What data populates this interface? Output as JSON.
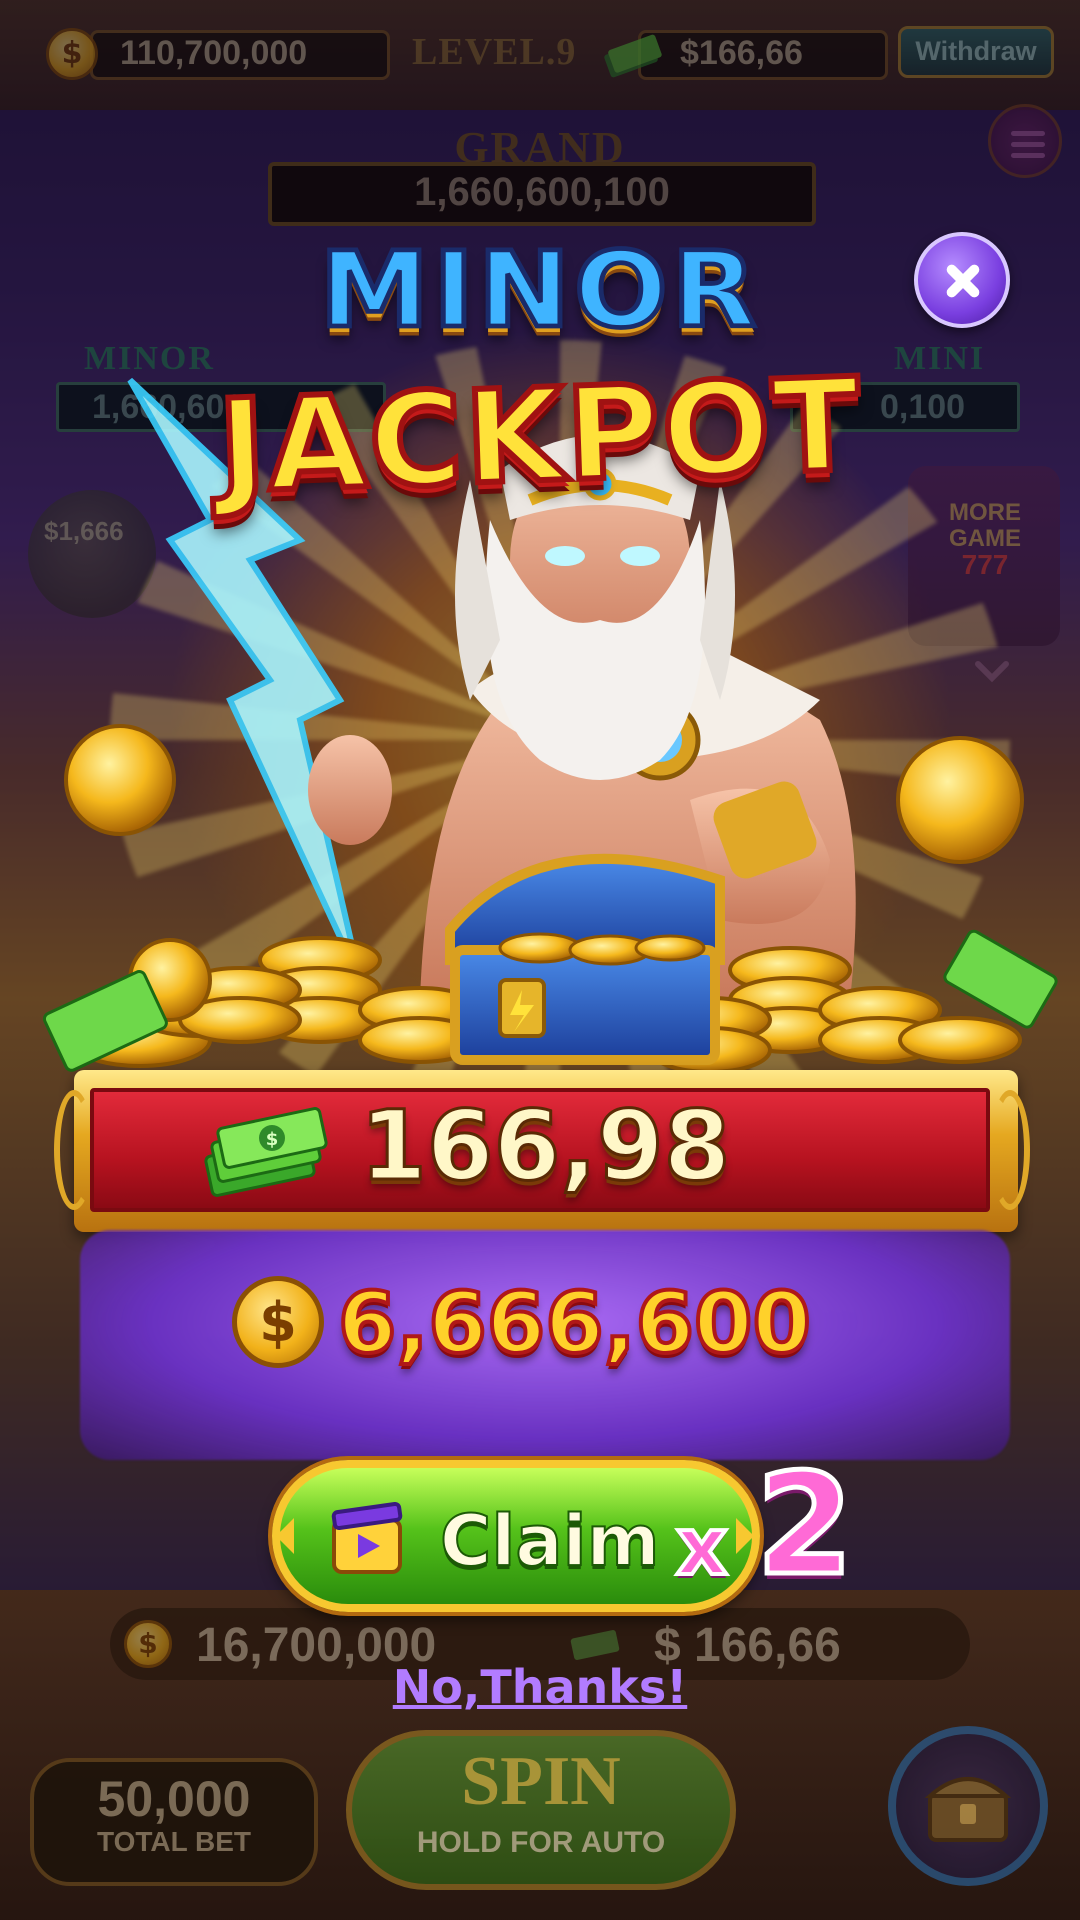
{
  "hud": {
    "coin_balance": "110,700,000",
    "level": "LEVEL.9",
    "cash_balance": "$166,66",
    "withdraw_label": "Withdraw"
  },
  "jackpots": {
    "grand_label": "GRAND",
    "grand_value": "1,660,600,100",
    "minor_label": "MINOR",
    "minor_value_partial": "1,660,600",
    "mini_label": "MINI",
    "mini_value_partial": "0,100"
  },
  "side": {
    "bubble_text": "$1,666",
    "more_game_text": "MORE GAME",
    "more_game_reels": "777"
  },
  "popup": {
    "title_line1": "MINOR",
    "title_line2": "JACKPOT",
    "cash_reward": "166,98",
    "coin_reward": "6,666,600",
    "claim_label": "Claim",
    "multiplier_x": "x",
    "multiplier_value": "2",
    "no_thanks_label": "No,Thanks!"
  },
  "bottom": {
    "coin_balance": "16,700,000",
    "cash_balance": "$ 166,66",
    "total_bet_value": "50,000",
    "total_bet_label": "TOTAL BET",
    "spin_label": "SPIN",
    "spin_sub_label": "HOLD FOR AUTO"
  },
  "icons": {
    "coin": "coin-icon",
    "cash": "cash-stack-icon",
    "close": "close-icon",
    "video": "video-ad-icon",
    "menu": "menu-icon",
    "chest": "treasure-chest-icon",
    "chevron": "chevron-down-icon"
  },
  "colors": {
    "title_blue": "#3fb4ff",
    "title_yellow": "#ffe23a",
    "banner_red": "#b5121f",
    "coin_amount": "#ffd12a",
    "claim_green": "#55c21a",
    "multiplier_pink": "#ff6ad6",
    "no_thanks_purple": "#b27cff",
    "close_purple": "#7a3fe0"
  }
}
